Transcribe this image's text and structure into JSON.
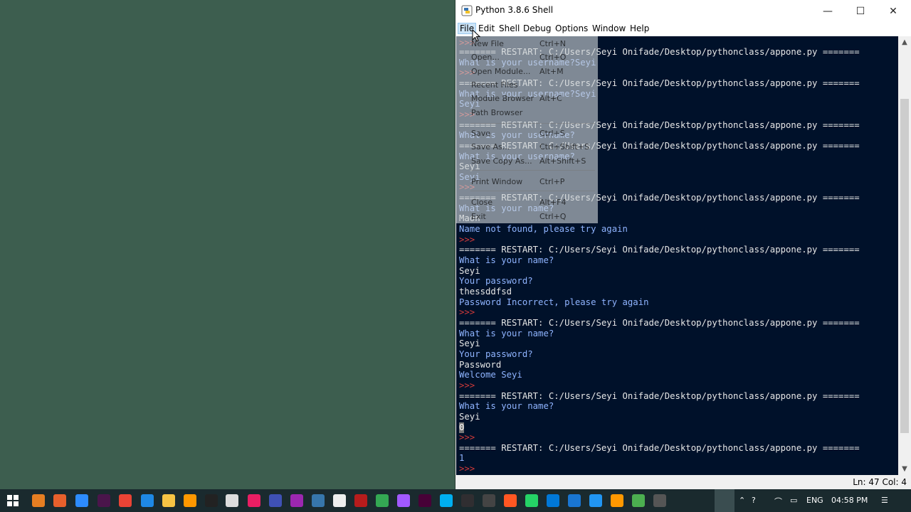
{
  "window": {
    "title": "Python 3.8.6 Shell",
    "minimize": "—",
    "maximize": "☐",
    "close": "✕"
  },
  "menu": {
    "file": "File",
    "edit": "Edit",
    "shell": "Shell",
    "debug": "Debug",
    "options": "Options",
    "window": "Window",
    "help": "Help"
  },
  "file_menu": [
    {
      "label": "New File",
      "shortcut": "Ctrl+N"
    },
    {
      "label": "Open...",
      "shortcut": "Ctrl+O"
    },
    {
      "label": "Open Module...",
      "shortcut": "Alt+M"
    },
    {
      "label": "Recent Files",
      "shortcut": ""
    },
    {
      "label": "Module Browser",
      "shortcut": "Alt+C"
    },
    {
      "label": "Path Browser",
      "shortcut": ""
    },
    {
      "label": "Save",
      "shortcut": "Ctrl+S"
    },
    {
      "label": "Save As...",
      "shortcut": "Ctrl+Shift+S"
    },
    {
      "label": "Save Copy As...",
      "shortcut": "Alt+Shift+S"
    },
    {
      "label": "Print Window",
      "shortcut": "Ctrl+P"
    },
    {
      "label": "Close",
      "shortcut": "Alt+F4"
    },
    {
      "label": "Exit",
      "shortcut": "Ctrl+Q"
    }
  ],
  "shell_lines": [
    {
      "text": ">>>",
      "kind": "prompt"
    },
    {
      "text": "======= RESTART: C:/Users/Seyi Onifade/Desktop/pythonclass/appone.py =======",
      "kind": "norm"
    },
    {
      "text": "What is your username?Seyi",
      "kind": "out"
    },
    {
      "text": ">>>",
      "kind": "prompt"
    },
    {
      "text": "======= RESTART: C:/Users/Seyi Onifade/Desktop/pythonclass/appone.py =======",
      "kind": "norm"
    },
    {
      "text": "What is your username?Seyi",
      "kind": "out"
    },
    {
      "text": "Seyi",
      "kind": "out"
    },
    {
      "text": ">>>",
      "kind": "prompt"
    },
    {
      "text": "======= RESTART: C:/Users/Seyi Onifade/Desktop/pythonclass/appone.py =======",
      "kind": "norm"
    },
    {
      "text": "What is your username?",
      "kind": "out"
    },
    {
      "text": "======= RESTART: C:/Users/Seyi Onifade/Desktop/pythonclass/appone.py =======",
      "kind": "norm"
    },
    {
      "text": "What is your username?",
      "kind": "out"
    },
    {
      "text": "Seyi",
      "kind": "norm"
    },
    {
      "text": "Seyi",
      "kind": "out"
    },
    {
      "text": ">>>",
      "kind": "prompt"
    },
    {
      "text": "======= RESTART: C:/Users/Seyi Onifade/Desktop/pythonclass/appone.py =======",
      "kind": "norm"
    },
    {
      "text": "What is your name?",
      "kind": "out"
    },
    {
      "text": "Maon",
      "kind": "norm"
    },
    {
      "text": "Name not found, please try again",
      "kind": "out"
    },
    {
      "text": ">>>",
      "kind": "prompt"
    },
    {
      "text": "======= RESTART: C:/Users/Seyi Onifade/Desktop/pythonclass/appone.py =======",
      "kind": "norm"
    },
    {
      "text": "What is your name?",
      "kind": "out"
    },
    {
      "text": "Seyi",
      "kind": "norm"
    },
    {
      "text": "Your password?",
      "kind": "out"
    },
    {
      "text": "thessddfsd",
      "kind": "norm"
    },
    {
      "text": "Password Incorrect, please try again",
      "kind": "out"
    },
    {
      "text": ">>>",
      "kind": "prompt"
    },
    {
      "text": "======= RESTART: C:/Users/Seyi Onifade/Desktop/pythonclass/appone.py =======",
      "kind": "norm"
    },
    {
      "text": "What is your name?",
      "kind": "out"
    },
    {
      "text": "Seyi",
      "kind": "norm"
    },
    {
      "text": "Your password?",
      "kind": "out"
    },
    {
      "text": "Password",
      "kind": "norm"
    },
    {
      "text": "Welcome Seyi",
      "kind": "out"
    },
    {
      "text": ">>>",
      "kind": "prompt"
    },
    {
      "text": "======= RESTART: C:/Users/Seyi Onifade/Desktop/pythonclass/appone.py =======",
      "kind": "norm"
    },
    {
      "text": "What is your name?",
      "kind": "out"
    },
    {
      "text": "Seyi",
      "kind": "norm"
    },
    {
      "text": "0",
      "kind": "cursor"
    },
    {
      "text": ">>>",
      "kind": "prompt"
    },
    {
      "text": "======= RESTART: C:/Users/Seyi Onifade/Desktop/pythonclass/appone.py =======",
      "kind": "norm"
    },
    {
      "text": "1",
      "kind": "out"
    },
    {
      "text": ">>>",
      "kind": "prompt"
    }
  ],
  "status": "Ln: 47  Col: 4",
  "taskbar": {
    "language": "ENG",
    "time": "04:58 PM",
    "icons": [
      "start-icon",
      "search-icon",
      "firefox-icon",
      "zoom-icon",
      "slack-icon",
      "chrome-icon",
      "vscode-icon",
      "file-explorer-icon",
      "sublime-icon",
      "terminal-icon",
      "unity-icon",
      "app-pink-icon",
      "app-blue-icon",
      "app-purple-icon",
      "python-icon",
      "notepad-icon",
      "filezilla-icon",
      "chrome-alt-icon",
      "figma-icon",
      "xd-icon",
      "skype-icon",
      "obs-icon",
      "app-dark-icon",
      "app-orange-icon",
      "whatsapp-icon",
      "edge-icon",
      "app-file-icon",
      "todo-icon",
      "app-yellow-icon",
      "app-green-icon",
      "python-shell-icon"
    ]
  },
  "colors": {
    "desktop": "#3d5e4f",
    "shell_bg": "#00112a",
    "prompt": "#d33a3a",
    "output": "#8fb4ff"
  }
}
